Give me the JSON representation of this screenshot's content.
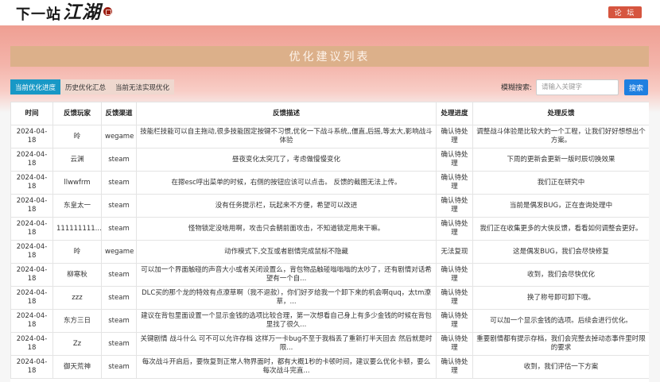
{
  "header": {
    "logo_small": "下一站",
    "logo_big": "江湖",
    "forum_button": "论 坛"
  },
  "page": {
    "title": "优化建议列表"
  },
  "tabs": [
    "当前优化进度",
    "历史优化汇总",
    "当前无法实现优化"
  ],
  "search": {
    "label": "模糊搜索:",
    "placeholder": "请输入关键字",
    "button": "搜索"
  },
  "table": {
    "columns": [
      "时间",
      "反馈玩家",
      "反馈渠道",
      "反馈描述",
      "处理进度",
      "处理反馈"
    ],
    "rows": [
      {
        "date": "2024-04-18",
        "player": "昤",
        "channel": "wegame",
        "desc": "技能栏技能可以自主拖动,很多技能固定按键不习惯,优化一下战斗系统,,僵直,后摇,等太大,影响战斗体验",
        "status": "确认待处理",
        "reply": "调整战斗体验是比较大的一个工程，让我们好好想想出个方案。"
      },
      {
        "date": "2024-04-18",
        "player": "云渊",
        "channel": "steam",
        "desc": "昼夜变化太突兀了，考虑做慢慢变化",
        "status": "确认待处理",
        "reply": "下周的更新会更新一版时辰切换效果"
      },
      {
        "date": "2024-04-18",
        "player": "llwwfrm",
        "channel": "steam",
        "desc": "在摁esc呼出菜单的时候，右侧的按钮应该可以点击。 反馈的截图无法上传。",
        "status": "确认待处理",
        "reply": "我们正在研究中"
      },
      {
        "date": "2024-04-18",
        "player": "东皇太一",
        "channel": "steam",
        "desc": "没有任务提示栏，玩起来不方便，希望可以改进",
        "status": "确认待处理",
        "reply": "当前是偶发BUG，正在查询处理中"
      },
      {
        "date": "2024-04-18",
        "player": "111111111...",
        "channel": "steam",
        "desc": "怪物锁定没啥用啊，攻击只会朝前面攻击，不知道锁定用来干嘛。",
        "status": "确认待处理",
        "reply": "我们正在收集更多的大侠反馈，看看如何调整会更好。"
      },
      {
        "date": "2024-04-18",
        "player": "昤",
        "channel": "wegame",
        "desc": "动作模式下,交互或者剧情完成鼠标不隐藏",
        "status": "无法复现",
        "reply": "这是偶发BUG，我们会尽快修复"
      },
      {
        "date": "2024-04-18",
        "player": "柳寒秋",
        "channel": "steam",
        "desc": "可以加一个界面触碰的声音大小或者关闭设置么，背包物品触碰嗡嗡嗡的太吵了，还有剧情对话希望有一个自...",
        "status": "确认待处理",
        "reply": "收到，我们会尽快优化"
      },
      {
        "date": "2024-04-18",
        "player": "zzz",
        "channel": "steam",
        "desc": "DLC买的那个龙的特效有点潦草啊（我不退款），你们好歹给我一个卸下来的机会啊quq，太tm潦草，...",
        "status": "确认待处理",
        "reply": "换了称号即可卸下哦。"
      },
      {
        "date": "2024-04-18",
        "player": "东方三日",
        "channel": "steam",
        "desc": "建议在背包里面设置一个显示金钱的选项比较合理，第一次想看自己身上有多少金钱的时候在背包里找了很久...",
        "status": "确认待处理",
        "reply": "可以加一个显示金钱的选项。后续会进行优化。"
      },
      {
        "date": "2024-04-18",
        "player": "Zz",
        "channel": "steam",
        "desc": "关键剧情 战斗什么 可不可以允许存档 这样万一卡bug不至于我档丢了重新打半天回去 然后就是时限...",
        "status": "确认待处理",
        "reply": "重要剧情都有提示存档，我们会完整去掉动态事件里时限的要求"
      },
      {
        "date": "2024-04-18",
        "player": "御天荒神",
        "channel": "steam",
        "desc": "每次战斗开启后，要恢复到正常人物界面时，都有大概1秒的卡顿时间，建议要么优化卡顿，要么每次战斗完直...",
        "status": "确认待处理",
        "reply": "收到，我们评估一下方案"
      }
    ]
  }
}
